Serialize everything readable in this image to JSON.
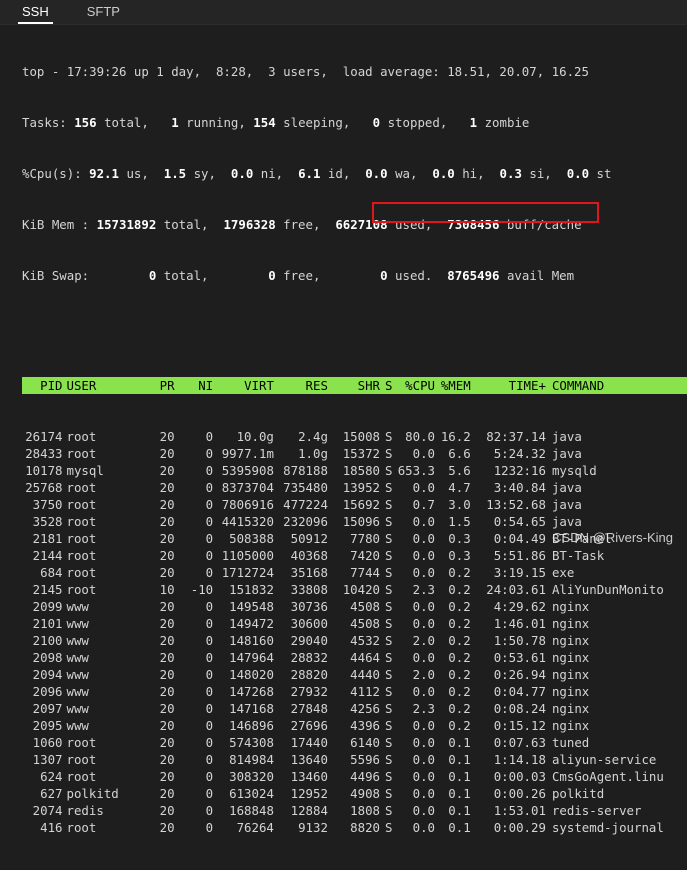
{
  "tabs": [
    {
      "label": "SSH",
      "active": true
    },
    {
      "label": "SFTP",
      "active": false
    }
  ],
  "summary": {
    "line1": "top - 17:39:26 up 1 day,  8:28,  3 users,  load average: 18.51, 20.07, 16.25",
    "tasks": {
      "prefix": "Tasks: ",
      "total": "156",
      "t1": " total,   ",
      "running": "1",
      "t2": " running, ",
      "sleeping": "154",
      "t3": " sleeping,   ",
      "stopped": "0",
      "t4": " stopped,   ",
      "zombie": "1",
      "t5": " zombie"
    },
    "cpu": {
      "prefix": "%Cpu(s): ",
      "us": "92.1",
      "t1": " us,  ",
      "sy": "1.5",
      "t2": " sy,  ",
      "ni": "0.0",
      "t3": " ni,  ",
      "id": "6.1",
      "t4": " id,  ",
      "wa": "0.0",
      "t5": " wa,  ",
      "hi": "0.0",
      "t6": " hi,  ",
      "si": "0.3",
      "t7": " si,  ",
      "st": "0.0",
      "t8": " st"
    },
    "mem": {
      "prefix": "KiB Mem : ",
      "total": "15731892",
      "t1": " total,  ",
      "free": "1796328",
      "t2": " free,  ",
      "used": "6627108",
      "t3": " used,  ",
      "buff": "7308456",
      "t4": " buff/cache"
    },
    "swap": {
      "prefix": "KiB Swap:        ",
      "total": "0",
      "t1": " total,        ",
      "free": "0",
      "t2": " free,        ",
      "used": "0",
      "t3": " used.  ",
      "avail": "8765496",
      "t4": " avail Mem"
    }
  },
  "columns": [
    "PID",
    "USER",
    "PR",
    "NI",
    "VIRT",
    "RES",
    "SHR",
    "S",
    "%CPU",
    "%MEM",
    "TIME+",
    "COMMAND"
  ],
  "processes": [
    [
      "26174",
      "root",
      "20",
      "0",
      "10.0g",
      "2.4g",
      "15008",
      "S",
      "80.0",
      "16.2",
      "82:37.14",
      "java"
    ],
    [
      "28433",
      "root",
      "20",
      "0",
      "9977.1m",
      "1.0g",
      "15372",
      "S",
      "0.0",
      "6.6",
      "5:24.32",
      "java"
    ],
    [
      "10178",
      "mysql",
      "20",
      "0",
      "5395908",
      "878188",
      "18580",
      "S",
      "653.3",
      "5.6",
      "1232:16",
      "mysqld"
    ],
    [
      "25768",
      "root",
      "20",
      "0",
      "8373704",
      "735480",
      "13952",
      "S",
      "0.0",
      "4.7",
      "3:40.84",
      "java"
    ],
    [
      "3750",
      "root",
      "20",
      "0",
      "7806916",
      "477224",
      "15692",
      "S",
      "0.7",
      "3.0",
      "13:52.68",
      "java"
    ],
    [
      "3528",
      "root",
      "20",
      "0",
      "4415320",
      "232096",
      "15096",
      "S",
      "0.0",
      "1.5",
      "0:54.65",
      "java"
    ],
    [
      "2181",
      "root",
      "20",
      "0",
      "508388",
      "50912",
      "7780",
      "S",
      "0.0",
      "0.3",
      "0:04.49",
      "BT-Panel"
    ],
    [
      "2144",
      "root",
      "20",
      "0",
      "1105000",
      "40368",
      "7420",
      "S",
      "0.0",
      "0.3",
      "5:51.86",
      "BT-Task"
    ],
    [
      "684",
      "root",
      "20",
      "0",
      "1712724",
      "35168",
      "7744",
      "S",
      "0.0",
      "0.2",
      "3:19.15",
      "exe"
    ],
    [
      "2145",
      "root",
      "10",
      "-10",
      "151832",
      "33808",
      "10420",
      "S",
      "2.3",
      "0.2",
      "24:03.61",
      "AliYunDunMonito"
    ],
    [
      "2099",
      "www",
      "20",
      "0",
      "149548",
      "30736",
      "4508",
      "S",
      "0.0",
      "0.2",
      "4:29.62",
      "nginx"
    ],
    [
      "2101",
      "www",
      "20",
      "0",
      "149472",
      "30600",
      "4508",
      "S",
      "0.0",
      "0.2",
      "1:46.01",
      "nginx"
    ],
    [
      "2100",
      "www",
      "20",
      "0",
      "148160",
      "29040",
      "4532",
      "S",
      "2.0",
      "0.2",
      "1:50.78",
      "nginx"
    ],
    [
      "2098",
      "www",
      "20",
      "0",
      "147964",
      "28832",
      "4464",
      "S",
      "0.0",
      "0.2",
      "0:53.61",
      "nginx"
    ],
    [
      "2094",
      "www",
      "20",
      "0",
      "148020",
      "28820",
      "4440",
      "S",
      "2.0",
      "0.2",
      "0:26.94",
      "nginx"
    ],
    [
      "2096",
      "www",
      "20",
      "0",
      "147268",
      "27932",
      "4112",
      "S",
      "0.0",
      "0.2",
      "0:04.77",
      "nginx"
    ],
    [
      "2097",
      "www",
      "20",
      "0",
      "147168",
      "27848",
      "4256",
      "S",
      "2.3",
      "0.2",
      "0:08.24",
      "nginx"
    ],
    [
      "2095",
      "www",
      "20",
      "0",
      "146896",
      "27696",
      "4396",
      "S",
      "0.0",
      "0.2",
      "0:15.12",
      "nginx"
    ],
    [
      "1060",
      "root",
      "20",
      "0",
      "574308",
      "17440",
      "6140",
      "S",
      "0.0",
      "0.1",
      "0:07.63",
      "tuned"
    ],
    [
      "1307",
      "root",
      "20",
      "0",
      "814984",
      "13640",
      "5596",
      "S",
      "0.0",
      "0.1",
      "1:14.18",
      "aliyun-service"
    ],
    [
      "624",
      "root",
      "20",
      "0",
      "308320",
      "13460",
      "4496",
      "S",
      "0.0",
      "0.1",
      "0:00.03",
      "CmsGoAgent.linu"
    ],
    [
      "627",
      "polkitd",
      "20",
      "0",
      "613024",
      "12952",
      "4908",
      "S",
      "0.0",
      "0.1",
      "0:00.26",
      "polkitd"
    ],
    [
      "2074",
      "redis",
      "20",
      "0",
      "168848",
      "12884",
      "1808",
      "S",
      "0.0",
      "0.1",
      "1:53.01",
      "redis-server"
    ],
    [
      "416",
      "root",
      "20",
      "0",
      "76264",
      "9132",
      "8820",
      "S",
      "0.0",
      "0.1",
      "0:00.29",
      "systemd-journal"
    ]
  ],
  "watermark": "CSDN @Rivers-King",
  "colors": {
    "header_bg": "#8ae34d",
    "highlight": "#e0161b",
    "background": "#1e1e1e"
  }
}
